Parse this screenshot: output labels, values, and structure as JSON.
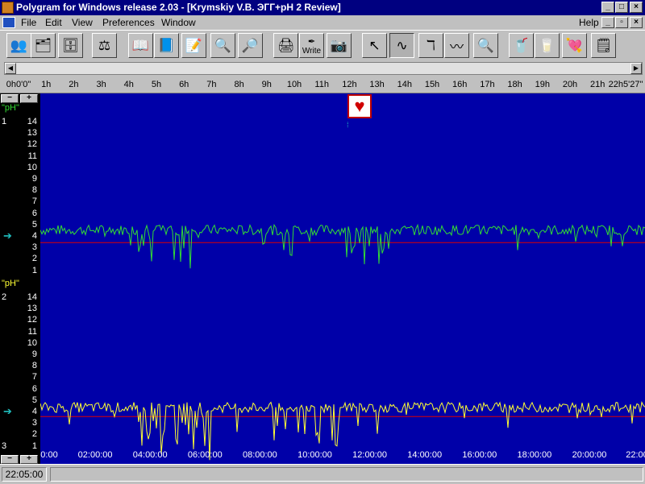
{
  "window": {
    "title": "Polygram for Windows release 2.03 - [Krymskiy V.B. ЭГГ+pH 2 Review]",
    "controls": [
      "_",
      "□",
      "×"
    ]
  },
  "menu": {
    "items": [
      "File",
      "Edit",
      "View",
      "Preferences",
      "Window"
    ],
    "help": "Help",
    "doc_controls": [
      "_",
      "▫",
      "×"
    ]
  },
  "toolbar": {
    "buttons": [
      {
        "icon": "patient-icon",
        "glyph": "👥"
      },
      {
        "icon": "database-icon",
        "glyph": "🗂"
      },
      {
        "icon": "file-cabinet-icon",
        "glyph": "🗄"
      },
      {
        "icon": "balance-scale-icon",
        "glyph": "⚖"
      },
      {
        "icon": "open-book-icon",
        "glyph": "📖"
      },
      {
        "icon": "export-book-icon",
        "glyph": "📘"
      },
      {
        "icon": "notes-icon",
        "glyph": "📝"
      },
      {
        "icon": "zoom-in-icon",
        "glyph": "🔍"
      },
      {
        "icon": "zoom-out-icon",
        "glyph": "🔎"
      },
      {
        "icon": "printer-icon",
        "glyph": "🖨"
      },
      {
        "icon": "write-icon",
        "glyph": "✒",
        "label": "Write"
      },
      {
        "icon": "camera-icon",
        "glyph": "📷"
      },
      {
        "icon": "pointer-icon",
        "glyph": "↖"
      },
      {
        "icon": "waveform-icon",
        "glyph": "∿",
        "pressed": true
      },
      {
        "icon": "marker-tool-icon",
        "glyph": "ℸ"
      },
      {
        "icon": "signal-scan-icon",
        "glyph": "〰"
      },
      {
        "icon": "magnifier-icon",
        "glyph": "🔍"
      },
      {
        "icon": "cup-icon",
        "glyph": "🥤"
      },
      {
        "icon": "empty-cup-icon",
        "glyph": "🥛"
      },
      {
        "icon": "heart-annotation-icon",
        "glyph": "💘"
      },
      {
        "icon": "sticky-note-icon",
        "glyph": "🗒"
      }
    ]
  },
  "ruler": {
    "hours": [
      "0h0'0\"",
      "1h",
      "2h",
      "3h",
      "4h",
      "5h",
      "6h",
      "7h",
      "8h",
      "9h",
      "10h",
      "11h",
      "12h",
      "13h",
      "14h",
      "15h",
      "16h",
      "17h",
      "18h",
      "19h",
      "20h",
      "21h",
      "22h5'27\""
    ]
  },
  "channels": [
    {
      "label": "\"pH\"",
      "number": "1",
      "color": "#33dd33",
      "threshold": 4,
      "scale": [
        "14",
        "13",
        "12",
        "11",
        "10",
        "9",
        "8",
        "7",
        "6",
        "5",
        "4",
        "3",
        "2",
        "1"
      ]
    },
    {
      "label": "\"pH\"",
      "number": "2",
      "color": "#ffff33",
      "threshold": 4,
      "scale": [
        "14",
        "13",
        "12",
        "11",
        "10",
        "9",
        "8",
        "7",
        "6",
        "5",
        "4",
        "3",
        "2",
        "1"
      ]
    }
  ],
  "third_channel_number": "3",
  "timeline": {
    "labels": [
      "0:00",
      "02:00:00",
      "04:00:00",
      "06:00:00",
      "08:00:00",
      "10:00:00",
      "12:00:00",
      "14:00:00",
      "16:00:00",
      "18:00:00",
      "20:00:00",
      "22:00"
    ]
  },
  "event_marker": {
    "icon": "heart-icon",
    "glyph": "♥"
  },
  "status": {
    "time": "22:05:00",
    "message": ""
  },
  "colors": {
    "plot_background": "#0000a8",
    "threshold_line": "#dd0000",
    "title_bar": "#000080"
  },
  "left_controls": {
    "minus": "−",
    "plus": "+"
  },
  "arrow_glyph": "➔"
}
